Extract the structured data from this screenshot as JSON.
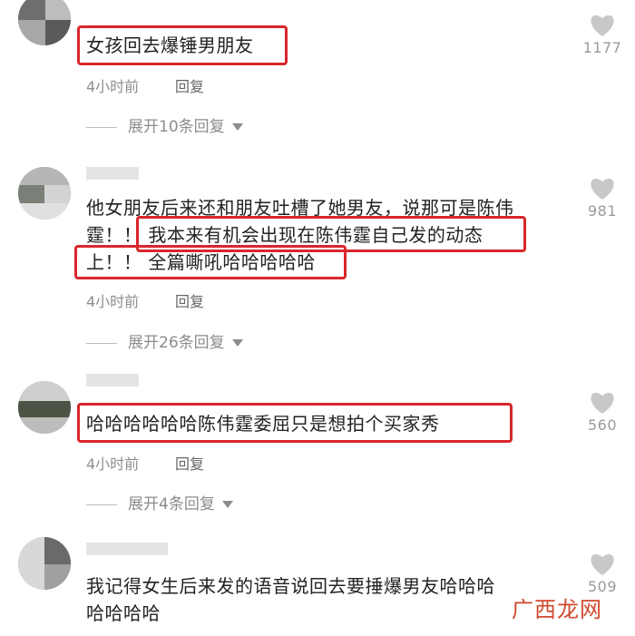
{
  "comments": [
    {
      "lines": [
        "女孩回去爆锤男朋友"
      ],
      "time": "4小时前",
      "reply": "回复",
      "expand": "展开10条回复",
      "likes": "1177"
    },
    {
      "lines": [
        "他女朋友后来还和朋友吐槽了她男友，说那可是陈伟",
        "霆！！ 我本来有机会出现在陈伟霆自己发的动态",
        "上！！ 全篇嘶吼哈哈哈哈哈"
      ],
      "time": "4小时前",
      "reply": "回复",
      "expand": "展开26条回复",
      "likes": "981"
    },
    {
      "lines": [
        "哈哈哈哈哈哈陈伟霆委屈只是想拍个买家秀"
      ],
      "time": "4小时前",
      "reply": "回复",
      "expand": "展开4条回复",
      "likes": "560"
    },
    {
      "lines": [
        "我记得女生后来发的语音说回去要捶爆男友哈哈哈",
        "哈哈哈哈"
      ],
      "likes": "509"
    }
  ],
  "watermark": "广西龙网",
  "colors": {
    "highlight": "#d9262b",
    "meta": "#8e8e8e",
    "heart": "#c8c8c8"
  }
}
